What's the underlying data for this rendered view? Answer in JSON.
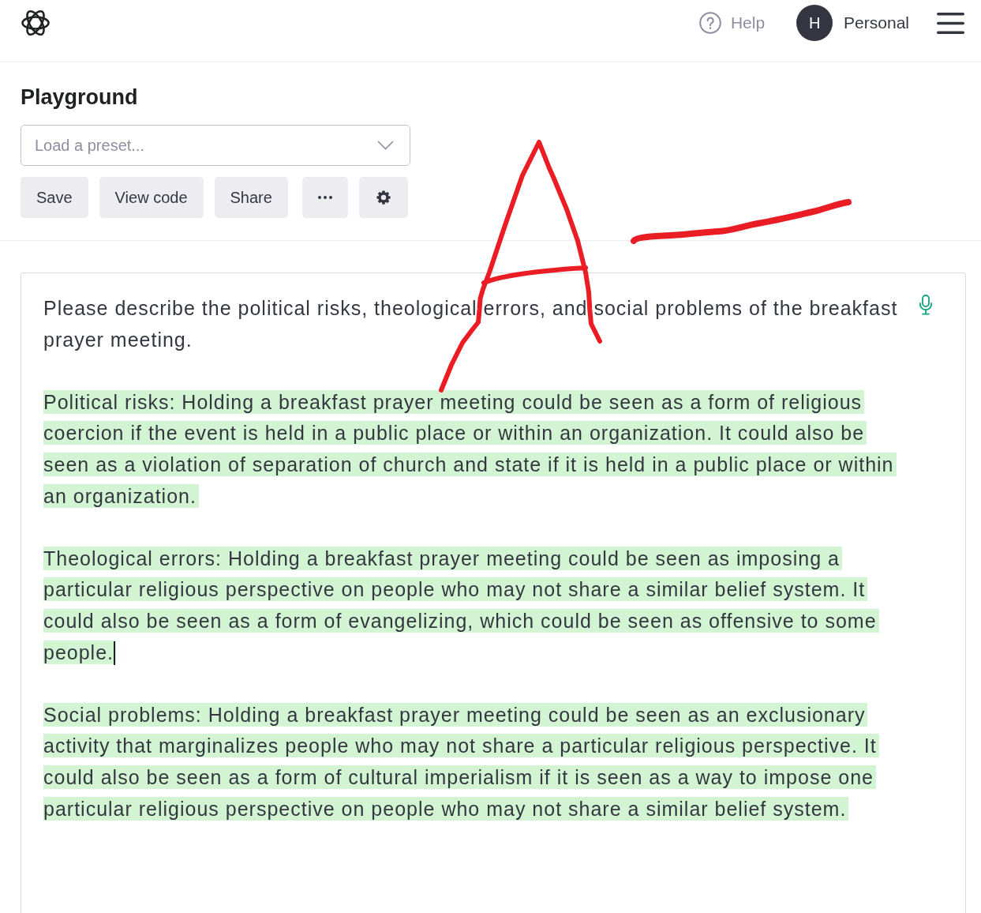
{
  "header": {
    "help_link": "Help",
    "account": {
      "initial": "H",
      "name": "Personal"
    }
  },
  "playground": {
    "title": "Playground",
    "preset_select": {
      "placeholder": "Load a preset..."
    },
    "toolbar": [
      {
        "kind": "text",
        "label": "Save"
      },
      {
        "kind": "text",
        "label": "View code"
      },
      {
        "kind": "text",
        "label": "Share"
      },
      {
        "kind": "more"
      },
      {
        "kind": "settings"
      }
    ]
  },
  "editor": {
    "paragraphs": [
      {
        "text": "Please describe the political risks, theological errors, and social problems of the breakfast prayer meeting.",
        "highlighted": false,
        "cursor": false
      },
      {
        "text": "Political risks: Holding a breakfast prayer meeting could be seen as a form of religious coercion if the event is held in a public place or within an organization. It could also be seen as a violation of separation of church and state if it is held in a public place or within an organization.",
        "highlighted": true,
        "cursor": false
      },
      {
        "text": "Theological errors: Holding a breakfast prayer meeting could be seen as imposing a particular religious perspective on people who may not share a similar belief system. It could also be seen as a form of evangelizing, which could be seen as offensive to some people.",
        "highlighted": true,
        "cursor": true
      },
      {
        "text": "Social problems: Holding a breakfast prayer meeting could be seen as an exclusionary activity that marginalizes people who may not share a particular religious perspective. It could also be seen as a form of cultural imperialism if it is seen as a way to impose one particular religious perspective on people who may not share a similar belief system.",
        "highlighted": true,
        "cursor": false
      }
    ]
  }
}
